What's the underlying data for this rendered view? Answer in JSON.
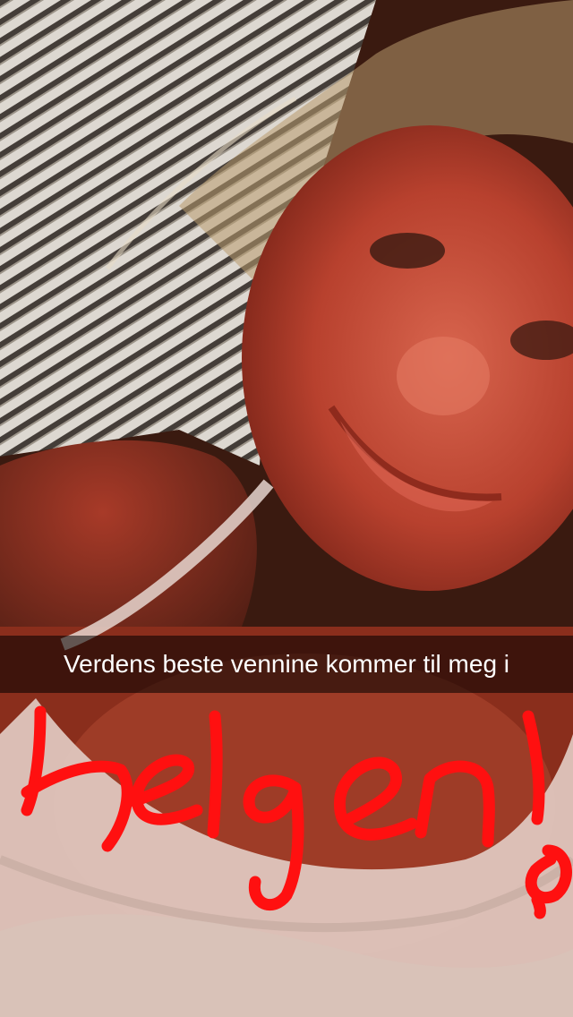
{
  "snap": {
    "caption": "Verdens beste vennine kommer til meg i",
    "drawing": {
      "text": "helgen!",
      "color": "#ff1010"
    }
  },
  "photo": {
    "description_icon": "selfie-photo"
  }
}
